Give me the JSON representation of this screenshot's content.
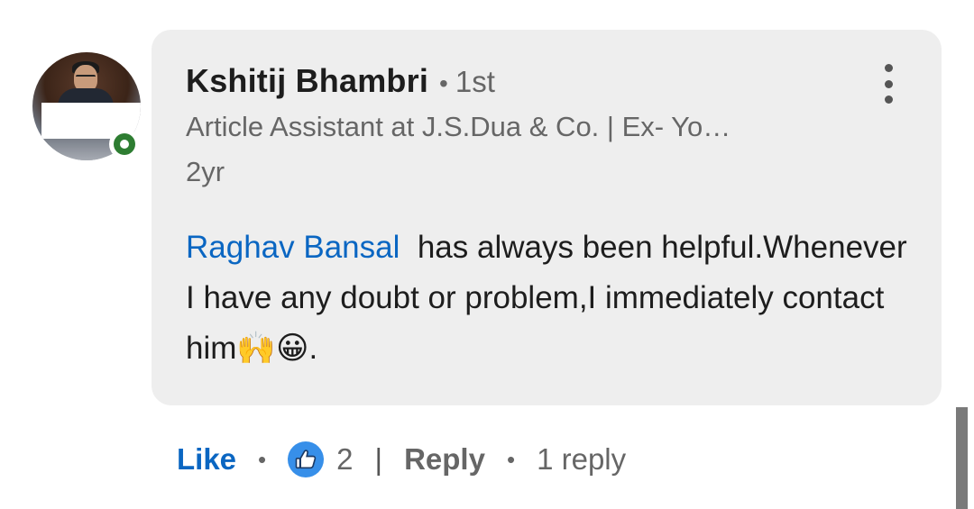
{
  "comment": {
    "author": {
      "name": "Kshitij Bhambri",
      "connection_degree": "1st",
      "headline": "Article Assistant at J.S.Dua & Co. | Ex- Yo…",
      "online_status": "online"
    },
    "timestamp": "2yr",
    "mention": "Raghav Bansal",
    "text": "has always been helpful.Whenever I have any doubt or problem,I immediately contact him",
    "emojis": "🙌😀",
    "end_punct": ".",
    "separator_dot": "•"
  },
  "actions": {
    "like_label": "Like",
    "reaction_count": "2",
    "divider": "|",
    "reply_label": "Reply",
    "replies_count": "1 reply"
  },
  "icons": {
    "avatar": "profile-photo",
    "status": "online-status-icon",
    "more": "more-vertical-icon",
    "reaction": "thumbs-up-icon"
  },
  "colors": {
    "bubble_bg": "#eeeeee",
    "link_blue": "#0a66c2",
    "reaction_blue": "#378fe9",
    "online_green": "#2e7d32",
    "text_primary": "#1d1d1d",
    "text_secondary": "#666666"
  }
}
